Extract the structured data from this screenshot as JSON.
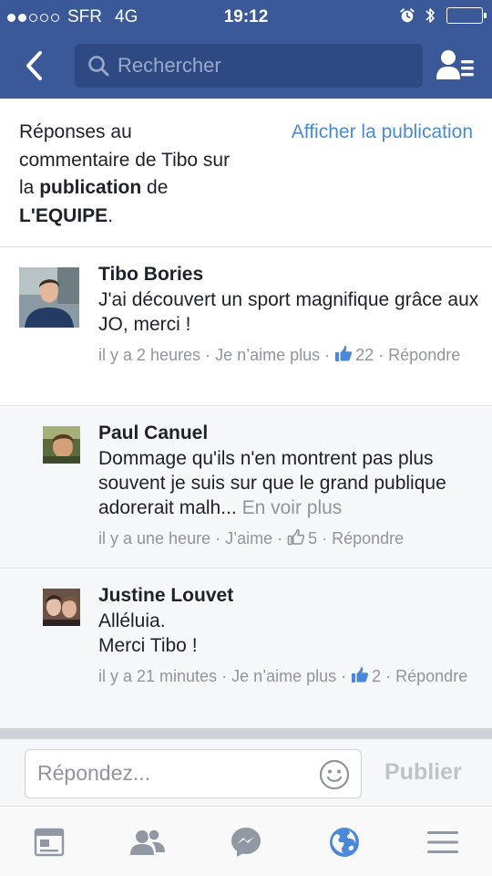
{
  "status_bar": {
    "carrier": "SFR",
    "network": "4G",
    "time": "19:12",
    "signal_bars_filled": 2,
    "signal_bars_total": 5
  },
  "nav": {
    "search_placeholder": "Rechercher"
  },
  "context": {
    "line1": "Réponses au commentaire de Tibo sur la ",
    "publication": "publication",
    "de": " de ",
    "page_name": "L'EQUIPE",
    "period": ".",
    "show_post_link": "Afficher la publication"
  },
  "comments": [
    {
      "name": "Tibo Bories",
      "text": "J'ai découvert un sport magnifique grâce aux JO, merci !",
      "time": "il y a 2 heures",
      "like_action": "Je n’aime plus",
      "like_count": "22",
      "reply_action": "Répondre"
    },
    {
      "name": "Paul Canuel",
      "text": "Dommage qu'ils n'en montrent pas plus souvent je suis sur que le grand publique adorerait malh...",
      "see_more": "En voir plus",
      "time": "il y a une heure",
      "like_action": "J’aime",
      "like_count": "5",
      "reply_action": "Répondre"
    },
    {
      "name": "Justine Louvet",
      "text_line1": "Alléluia.",
      "text_line2": "Merci Tibo !",
      "time": "il y a 21 minutes",
      "like_action": "Je n’aime plus",
      "like_count": "2",
      "reply_action": "Répondre"
    }
  ],
  "composer": {
    "placeholder": "Répondez...",
    "publish_label": "Publier"
  },
  "tabs": [
    "news-feed",
    "friends",
    "messenger",
    "notifications",
    "more"
  ],
  "colors": {
    "brand_blue": "#3b5998",
    "link_blue": "#4b89d8",
    "muted_text": "#90949c",
    "active_tab": "#4b89d8",
    "inactive_tab": "#9197a3"
  }
}
